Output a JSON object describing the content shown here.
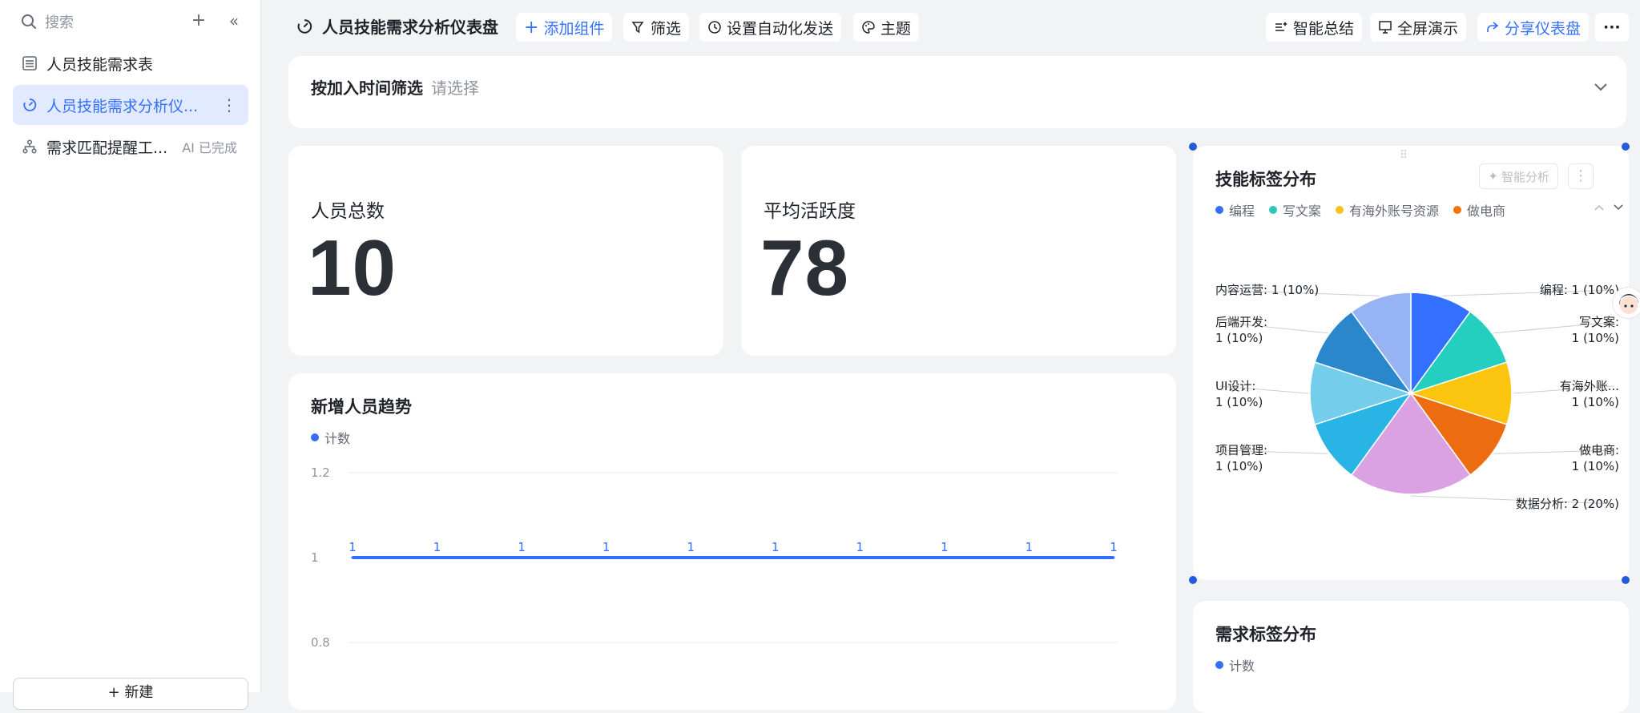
{
  "sidebar": {
    "search_placeholder": "搜索",
    "items": [
      {
        "label": "人员技能需求表",
        "icon": "table-icon"
      },
      {
        "label": "人员技能需求分析仪...",
        "icon": "dashboard-icon",
        "active": true
      },
      {
        "label": "需求匹配提醒工...",
        "icon": "workflow-icon",
        "meta": "AI 已完成"
      }
    ],
    "new_label": "+ 新建"
  },
  "topbar": {
    "title": "人员技能需求分析仪表盘",
    "add_widget": "添加组件",
    "filter": "筛选",
    "auto_send": "设置自动化发送",
    "theme": "主题",
    "smart_summary": "智能总结",
    "fullscreen": "全屏演示",
    "share": "分享仪表盘",
    "more": "···"
  },
  "filter_card": {
    "label": "按加入时间筛选",
    "placeholder": "请选择"
  },
  "stats": [
    {
      "title": "人员总数",
      "value": "10"
    },
    {
      "title": "平均活跃度",
      "value": "78"
    }
  ],
  "trend": {
    "title": "新增人员趋势",
    "legend": "计数",
    "color": "#3370ff",
    "chart_data": {
      "type": "line",
      "x": [
        "",
        "",
        "",
        "",
        "",
        "",
        "",
        "",
        "",
        ""
      ],
      "series": [
        {
          "name": "计数",
          "values": [
            1,
            1,
            1,
            1,
            1,
            1,
            1,
            1,
            1,
            1
          ]
        }
      ],
      "ylim": [
        0.8,
        1.2
      ],
      "yticks": [
        "1.2",
        "1",
        "0.8"
      ],
      "data_labels": [
        "1",
        "1",
        "1",
        "1",
        "1",
        "1",
        "1",
        "1",
        "1",
        "1"
      ]
    }
  },
  "skills": {
    "title": "技能标签分布",
    "ai_label": "智能分析",
    "legend": [
      {
        "name": "编程",
        "color": "#3370ff"
      },
      {
        "name": "写文案",
        "color": "#2ec7c0"
      },
      {
        "name": "有海外账号资源",
        "color": "#fac21c"
      },
      {
        "name": "做电商",
        "color": "#f2720e"
      }
    ],
    "chart_data": {
      "type": "pie",
      "slices": [
        {
          "name": "编程",
          "value": 1,
          "pct": 10,
          "color": "#3370ff",
          "label": "编程: 1 (10%)"
        },
        {
          "name": "写文案",
          "value": 1,
          "pct": 10,
          "color": "#24cfc0",
          "label_a": "写文案:",
          "label_b": "1 (10%)"
        },
        {
          "name": "有海外账号资源",
          "value": 1,
          "pct": 10,
          "color": "#fbc50f",
          "label_a": "有海外账...",
          "label_b": "1 (10%)"
        },
        {
          "name": "做电商",
          "value": 1,
          "pct": 10,
          "color": "#ee6c10",
          "label_a": "做电商:",
          "label_b": "1 (10%)"
        },
        {
          "name": "数据分析",
          "value": 2,
          "pct": 20,
          "color": "#dba2e3",
          "label": "数据分析: 2 (20%)"
        },
        {
          "name": "项目管理",
          "value": 1,
          "pct": 10,
          "color": "#28b4e4",
          "label_a": "项目管理:",
          "label_b": "1 (10%)"
        },
        {
          "name": "UI设计",
          "value": 1,
          "pct": 10,
          "color": "#74cdea",
          "label_a": "UI设计:",
          "label_b": "1 (10%)"
        },
        {
          "name": "后端开发",
          "value": 1,
          "pct": 10,
          "color": "#2a87cc",
          "label_a": "后端开发:",
          "label_b": "1 (10%)"
        },
        {
          "name": "内容运营",
          "value": 1,
          "pct": 10,
          "color": "#96b3f3",
          "label": "内容运营: 1 (10%)"
        }
      ]
    }
  },
  "needs": {
    "title": "需求标签分布",
    "legend": "计数"
  }
}
